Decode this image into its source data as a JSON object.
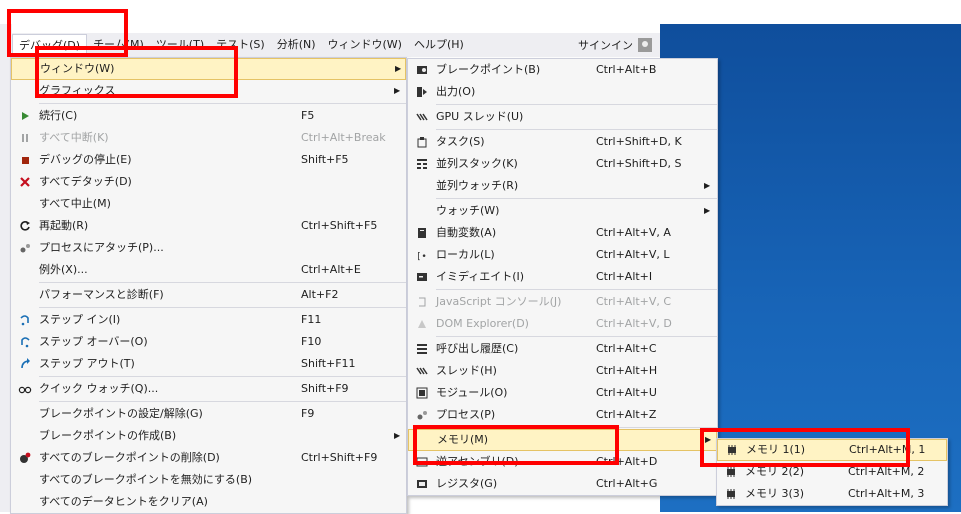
{
  "menubar": {
    "items": [
      "デバッグ(D)",
      "チーム(M)",
      "ツール(T)",
      "テスト(S)",
      "分析(N)",
      "ウィンドウ(W)",
      "ヘルプ(H)"
    ],
    "signin": "サインイン"
  },
  "debug_menu": {
    "items": [
      {
        "label": "ウィンドウ(W)",
        "shortcut": "",
        "icon": "",
        "submenu": true,
        "highlight": true
      },
      {
        "label": "グラフィックス",
        "shortcut": "",
        "icon": "",
        "submenu": true
      },
      {
        "sep": true
      },
      {
        "label": "続行(C)",
        "shortcut": "F5",
        "icon": "play-icon"
      },
      {
        "label": "すべて中断(K)",
        "shortcut": "Ctrl+Alt+Break",
        "icon": "pause-icon",
        "disabled": true
      },
      {
        "label": "デバッグの停止(E)",
        "shortcut": "Shift+F5",
        "icon": "stop-icon"
      },
      {
        "label": "すべてデタッチ(D)",
        "shortcut": "",
        "icon": "detach-x-icon"
      },
      {
        "label": "すべて中止(M)",
        "shortcut": "",
        "icon": ""
      },
      {
        "label": "再起動(R)",
        "shortcut": "Ctrl+Shift+F5",
        "icon": "restart-icon"
      },
      {
        "label": "プロセスにアタッチ(P)...",
        "shortcut": "",
        "icon": "attach-process-icon"
      },
      {
        "label": "例外(X)...",
        "shortcut": "Ctrl+Alt+E",
        "icon": ""
      },
      {
        "sep": true
      },
      {
        "label": "パフォーマンスと診断(F)",
        "shortcut": "Alt+F2",
        "icon": ""
      },
      {
        "sep": true
      },
      {
        "label": "ステップ イン(I)",
        "shortcut": "F11",
        "icon": "step-into-icon"
      },
      {
        "label": "ステップ オーバー(O)",
        "shortcut": "F10",
        "icon": "step-over-icon"
      },
      {
        "label": "ステップ アウト(T)",
        "shortcut": "Shift+F11",
        "icon": "step-out-icon"
      },
      {
        "sep": true
      },
      {
        "label": "クイック ウォッチ(Q)...",
        "shortcut": "Shift+F9",
        "icon": "glasses-icon"
      },
      {
        "sep": true
      },
      {
        "label": "ブレークポイントの設定/解除(G)",
        "shortcut": "F9",
        "icon": ""
      },
      {
        "label": "ブレークポイントの作成(B)",
        "shortcut": "",
        "icon": "",
        "submenu": true
      },
      {
        "label": "すべてのブレークポイントの削除(D)",
        "shortcut": "Ctrl+Shift+F9",
        "icon": "delete-breakpoints-icon"
      },
      {
        "label": "すべてのブレークポイントを無効にする(B)",
        "shortcut": "",
        "icon": ""
      },
      {
        "label": "すべてのデータヒントをクリア(A)",
        "shortcut": "",
        "icon": ""
      }
    ]
  },
  "windows_submenu": {
    "items": [
      {
        "label": "ブレークポイント(B)",
        "shortcut": "Ctrl+Alt+B",
        "icon": "breakpoints-window-icon"
      },
      {
        "label": "出力(O)",
        "shortcut": "",
        "icon": "output-icon"
      },
      {
        "sep": true
      },
      {
        "label": "GPU スレッド(U)",
        "shortcut": "",
        "icon": "gpu-threads-icon"
      },
      {
        "sep": true
      },
      {
        "label": "タスク(S)",
        "shortcut": "Ctrl+Shift+D, K",
        "icon": "tasks-icon"
      },
      {
        "label": "並列スタック(K)",
        "shortcut": "Ctrl+Shift+D, S",
        "icon": "parallel-stacks-icon"
      },
      {
        "label": "並列ウォッチ(R)",
        "shortcut": "",
        "icon": "",
        "submenu": true
      },
      {
        "sep": true
      },
      {
        "label": "ウォッチ(W)",
        "shortcut": "",
        "icon": "",
        "submenu": true
      },
      {
        "label": "自動変数(A)",
        "shortcut": "Ctrl+Alt+V, A",
        "icon": "autos-icon"
      },
      {
        "label": "ローカル(L)",
        "shortcut": "Ctrl+Alt+V, L",
        "icon": "locals-icon"
      },
      {
        "label": "イミディエイト(I)",
        "shortcut": "Ctrl+Alt+I",
        "icon": "immediate-icon"
      },
      {
        "sep": true
      },
      {
        "label": "JavaScript コンソール(J)",
        "shortcut": "Ctrl+Alt+V, C",
        "icon": "js-console-icon",
        "disabled": true
      },
      {
        "label": "DOM Explorer(D)",
        "shortcut": "Ctrl+Alt+V, D",
        "icon": "dom-explorer-icon",
        "disabled": true
      },
      {
        "sep": true
      },
      {
        "label": "呼び出し履歴(C)",
        "shortcut": "Ctrl+Alt+C",
        "icon": "call-stack-icon"
      },
      {
        "label": "スレッド(H)",
        "shortcut": "Ctrl+Alt+H",
        "icon": "threads-icon"
      },
      {
        "label": "モジュール(O)",
        "shortcut": "Ctrl+Alt+U",
        "icon": "modules-icon"
      },
      {
        "label": "プロセス(P)",
        "shortcut": "Ctrl+Alt+Z",
        "icon": "processes-icon"
      },
      {
        "sep": true
      },
      {
        "label": "メモリ(M)",
        "shortcut": "",
        "icon": "",
        "submenu": true,
        "highlight": true
      },
      {
        "label": "逆アセンブリ(D)",
        "shortcut": "Ctrl+Alt+D",
        "icon": "disassembly-icon"
      },
      {
        "label": "レジスタ(G)",
        "shortcut": "Ctrl+Alt+G",
        "icon": "registers-icon"
      }
    ]
  },
  "memory_submenu": {
    "items": [
      {
        "label": "メモリ 1(1)",
        "shortcut": "Ctrl+Alt+M, 1",
        "icon": "memory-icon",
        "highlight": true
      },
      {
        "label": "メモリ 2(2)",
        "shortcut": "Ctrl+Alt+M, 2",
        "icon": "memory-icon"
      },
      {
        "label": "メモリ 3(3)",
        "shortcut": "Ctrl+Alt+M, 3",
        "icon": "memory-icon"
      }
    ]
  },
  "colors": {
    "highlight_red": "#ff0000",
    "menu_bg": "#f6f6f6",
    "hover_bg": "#fff3c4",
    "desktop_blue": "#1a5ea8"
  }
}
